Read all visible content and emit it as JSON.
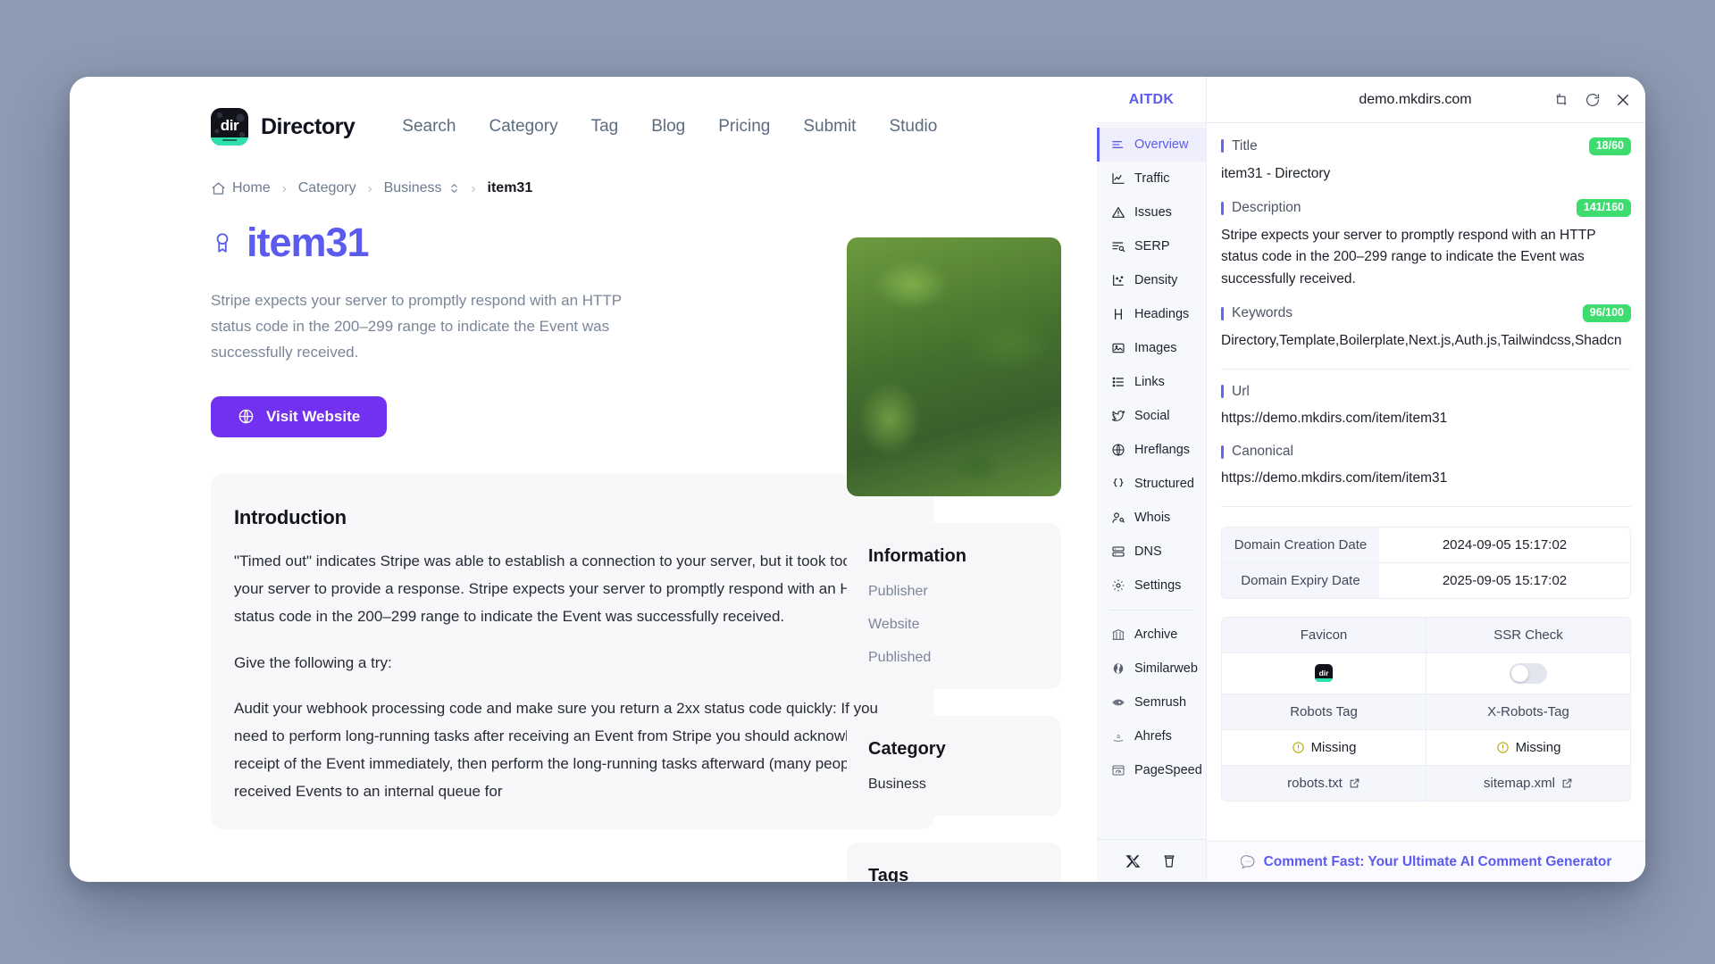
{
  "site": {
    "brand_mark": "dir",
    "brand_name": "Directory",
    "nav": [
      {
        "label": "Search"
      },
      {
        "label": "Category"
      },
      {
        "label": "Tag"
      },
      {
        "label": "Blog"
      },
      {
        "label": "Pricing"
      },
      {
        "label": "Submit"
      },
      {
        "label": "Studio"
      }
    ]
  },
  "breadcrumb": {
    "home": "Home",
    "category": "Category",
    "business": "Business",
    "current": "item31"
  },
  "item": {
    "title": "item31",
    "tagline": "Stripe expects your server to promptly respond with an HTTP status code in the 200–299 range to indicate the Event was successfully received.",
    "visit_button": "Visit Website"
  },
  "article": {
    "heading": "Introduction",
    "paragraphs": [
      "\"Timed out\" indicates Stripe was able to establish a connection to your server, but it took too long for your server to provide a response. Stripe expects your server to promptly respond with an HTTP status code in the 200–299 range to indicate the Event was successfully received.",
      "Give the following a try:",
      "Audit your webhook processing code and make sure you return a 2xx status code quickly: If you need to perform long-running tasks after receiving an Event from Stripe you should acknowledge receipt of the Event immediately, then perform the long-running tasks afterward (many people add received Events to an internal queue for"
    ]
  },
  "page_rail": {
    "information": {
      "heading": "Information",
      "rows": [
        "Publisher",
        "Website",
        "Published"
      ]
    },
    "category": {
      "heading": "Category",
      "value": "Business"
    },
    "tags": {
      "heading": "Tags"
    }
  },
  "extension": {
    "brand": "AITDK",
    "url": "demo.mkdirs.com",
    "header_actions": [
      {
        "name": "expand-icon"
      },
      {
        "name": "refresh-icon"
      },
      {
        "name": "close-icon"
      }
    ],
    "nav": [
      {
        "label": "Overview",
        "icon": "overview-icon",
        "active": true
      },
      {
        "label": "Traffic",
        "icon": "traffic-icon",
        "active": false
      },
      {
        "label": "Issues",
        "icon": "issues-icon",
        "active": false
      },
      {
        "label": "SERP",
        "icon": "serp-icon",
        "active": false
      },
      {
        "label": "Density",
        "icon": "density-icon",
        "active": false
      },
      {
        "label": "Headings",
        "icon": "headings-icon",
        "active": false
      },
      {
        "label": "Images",
        "icon": "images-icon",
        "active": false
      },
      {
        "label": "Links",
        "icon": "links-icon",
        "active": false
      },
      {
        "label": "Social",
        "icon": "social-icon",
        "active": false
      },
      {
        "label": "Hreflangs",
        "icon": "hreflangs-icon",
        "active": false
      },
      {
        "label": "Structured",
        "icon": "structured-icon",
        "active": false
      },
      {
        "label": "Whois",
        "icon": "whois-icon",
        "active": false
      },
      {
        "label": "DNS",
        "icon": "dns-icon",
        "active": false
      },
      {
        "label": "Settings",
        "icon": "settings-icon",
        "active": false
      }
    ],
    "nav_tools": [
      {
        "label": "Archive",
        "icon": "archive-icon"
      },
      {
        "label": "Similarweb",
        "icon": "similarweb-icon"
      },
      {
        "label": "Semrush",
        "icon": "semrush-icon"
      },
      {
        "label": "Ahrefs",
        "icon": "ahrefs-icon"
      },
      {
        "label": "PageSpeed",
        "icon": "pagespeed-icon"
      }
    ],
    "footer_icons": [
      {
        "name": "x-twitter-icon"
      },
      {
        "name": "coffee-icon"
      }
    ],
    "seo": {
      "title": {
        "label": "Title",
        "badge": "18/60",
        "value": "item31 - Directory"
      },
      "description": {
        "label": "Description",
        "badge": "141/160",
        "value": "Stripe expects your server to promptly respond with an HTTP status code in the 200–299 range to indicate the Event was successfully received."
      },
      "keywords": {
        "label": "Keywords",
        "badge": "96/100",
        "value": "Directory,Template,Boilerplate,Next.js,Auth.js,Tailwindcss,Shadcn"
      },
      "url": {
        "label": "Url",
        "value": "https://demo.mkdirs.com/item/item31"
      },
      "canonical": {
        "label": "Canonical",
        "value": "https://demo.mkdirs.com/item/item31"
      }
    },
    "domain_table": [
      {
        "key": "Domain Creation Date",
        "value": "2024-09-05 15:17:02"
      },
      {
        "key": "Domain Expiry Date",
        "value": "2025-09-05 15:17:02"
      }
    ],
    "checks_table": {
      "head_1": [
        "Favicon",
        "SSR Check"
      ],
      "body_1": [
        "dir",
        "toggle-off"
      ],
      "head_2": [
        "Robots Tag",
        "X-Robots-Tag"
      ],
      "body_2": [
        "Missing",
        "Missing"
      ],
      "head_3": [
        "robots.txt",
        "sitemap.xml"
      ]
    },
    "promo": "Comment Fast: Your Ultimate AI Comment Generator"
  },
  "colors": {
    "accent_purple": "#5b5bf0",
    "button_purple": "#7230f0",
    "badge_green": "#3ddc6e",
    "page_bg": "#8e9bb3"
  }
}
